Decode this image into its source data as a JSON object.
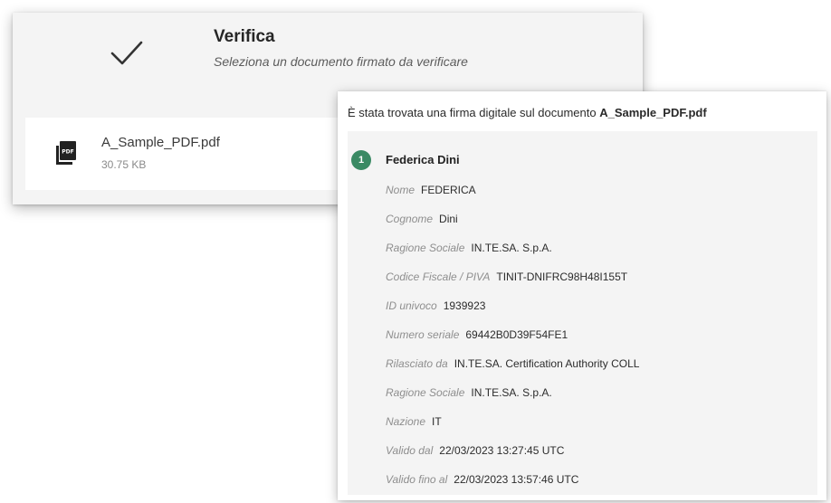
{
  "verify": {
    "title": "Verifica",
    "subtitle": "Seleziona un documento firmato da verificare",
    "check_icon": "checkmark-icon",
    "file": {
      "icon": "pdf-file-icon",
      "name": "A_Sample_PDF.pdf",
      "size": "30.75 KB"
    }
  },
  "signature": {
    "header_prefix": "È stata trovata una firma digitale sul documento",
    "header_document": "A_Sample_PDF.pdf",
    "signer": {
      "index": "1",
      "name": "Federica Dini",
      "badge_color": "#3a8a64"
    },
    "fields": [
      {
        "label": "Nome",
        "value": "FEDERICA"
      },
      {
        "label": "Cognome",
        "value": "Dini"
      },
      {
        "label": "Ragione Sociale",
        "value": "IN.TE.SA. S.p.A."
      },
      {
        "label": "Codice Fiscale / PIVA",
        "value": "TINIT-DNIFRC98H48I155T"
      },
      {
        "label": "ID univoco",
        "value": "1939923"
      },
      {
        "label": "Numero seriale",
        "value": "69442B0D39F54FE1"
      },
      {
        "label": "Rilasciato da",
        "value": "IN.TE.SA. Certification Authority COLL"
      },
      {
        "label": "Ragione Sociale",
        "value": "IN.TE.SA. S.p.A."
      },
      {
        "label": "Nazione",
        "value": "IT"
      },
      {
        "label": "Valido dal",
        "value": "22/03/2023 13:27:45 UTC"
      },
      {
        "label": "Valido fino al",
        "value": "22/03/2023 13:57:46 UTC"
      }
    ]
  }
}
